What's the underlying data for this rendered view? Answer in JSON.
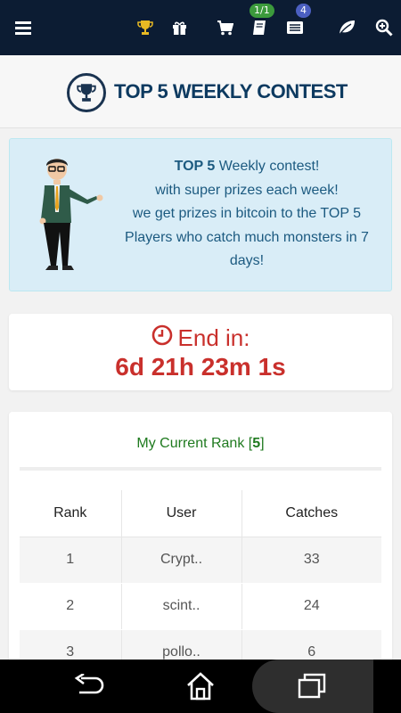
{
  "topbar": {
    "icons": [
      "menu-icon",
      "trophy-icon",
      "gift-icon",
      "cart-icon",
      "book-icon",
      "newspaper-icon",
      "leaf-icon",
      "search-plus-icon"
    ],
    "book_badge": "1/1",
    "news_badge": "4"
  },
  "header": {
    "title": "TOP 5 WEEKLY CONTEST"
  },
  "info": {
    "bold": "TOP 5",
    "line1_rest": " Weekly contest!",
    "line2": "with super prizes each week!",
    "line3": "we get prizes in bitcoin to the TOP 5",
    "line4": "Players who catch much monsters in 7",
    "line5": "days!"
  },
  "timer": {
    "label": "End in:",
    "value": "6d 21h 23m 1s"
  },
  "rank": {
    "prefix": "My Current Rank [",
    "value": "5",
    "suffix": "]"
  },
  "table": {
    "headers": [
      "Rank",
      "User",
      "Catches"
    ],
    "rows": [
      [
        "1",
        "Crypt..",
        "33"
      ],
      [
        "2",
        "scint..",
        "24"
      ],
      [
        "3",
        "pollo..",
        "6"
      ]
    ]
  },
  "colors": {
    "topbar": "#0c1c33",
    "accent_red": "#c9302c",
    "title_blue": "#0d3a60",
    "rank_green": "#1f7a1f",
    "badge_green": "#3c9a3c",
    "badge_blue": "#4b5fc1",
    "trophy_gold": "#e8b923"
  }
}
